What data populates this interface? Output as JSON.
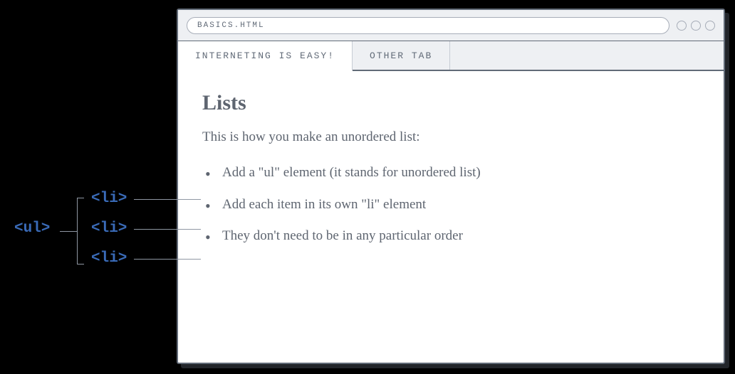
{
  "address_value": "BASICS.HTML",
  "tabs": [
    {
      "label": "INTERNETING IS EASY!"
    },
    {
      "label": "OTHER TAB"
    }
  ],
  "page": {
    "heading": "Lists",
    "intro": "This is how you make an unordered list:",
    "items": [
      "Add a \"ul\" element (it stands for unordered list)",
      "Add each item in its own \"li\" element",
      "They don't need to be in any particular order"
    ]
  },
  "annotations": {
    "ul_tag": "<ul>",
    "li_tag": "<li>"
  }
}
